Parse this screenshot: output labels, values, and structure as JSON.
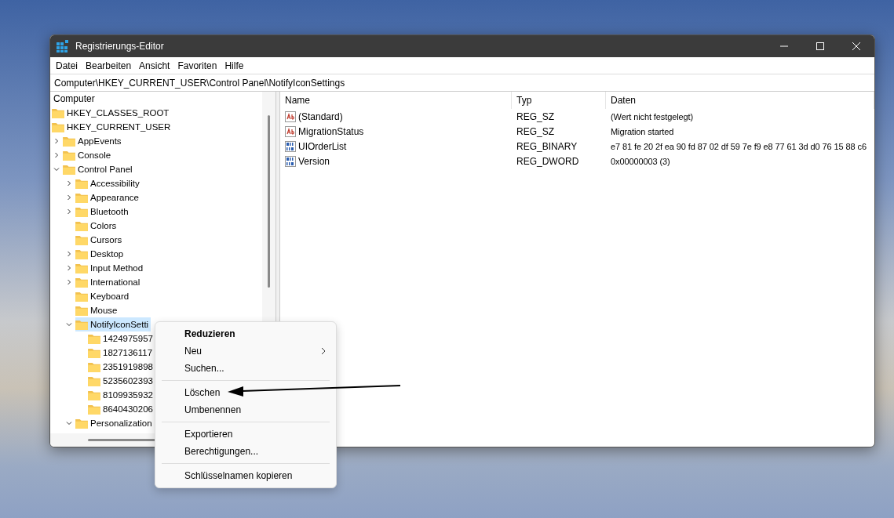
{
  "window": {
    "title": "Registrierungs-Editor"
  },
  "menu_bar": [
    "Datei",
    "Bearbeiten",
    "Ansicht",
    "Favoriten",
    "Hilfe"
  ],
  "address": "Computer\\HKEY_CURRENT_USER\\Control Panel\\NotifyIconSettings",
  "tree": {
    "root": "Computer",
    "items": [
      {
        "label": "HKEY_CLASSES_ROOT",
        "selected": false
      },
      {
        "label": "HKEY_CURRENT_USER",
        "selected": false,
        "children": [
          {
            "label": "AppEvents",
            "expanded": false,
            "selected": false
          },
          {
            "label": "Console",
            "expanded": false,
            "selected": false
          },
          {
            "label": "Control Panel",
            "expanded": true,
            "selected": false,
            "children": [
              {
                "label": "Accessibility",
                "expanded": false,
                "selected": false
              },
              {
                "label": "Appearance",
                "expanded": false,
                "selected": false
              },
              {
                "label": "Bluetooth",
                "expanded": false,
                "selected": false
              },
              {
                "label": "Colors",
                "selected": false
              },
              {
                "label": "Cursors",
                "selected": false
              },
              {
                "label": "Desktop",
                "expanded": false,
                "selected": false
              },
              {
                "label": "Input Method",
                "expanded": false,
                "selected": false
              },
              {
                "label": "International",
                "expanded": false,
                "selected": false
              },
              {
                "label": "Keyboard",
                "selected": false
              },
              {
                "label": "Mouse",
                "selected": false
              },
              {
                "label": "NotifyIconSetti",
                "expanded": true,
                "selected": true,
                "children": [
                  {
                    "label": "1424975957",
                    "selected": false
                  },
                  {
                    "label": "1827136117",
                    "selected": false
                  },
                  {
                    "label": "2351919898",
                    "selected": false
                  },
                  {
                    "label": "5235602393",
                    "selected": false
                  },
                  {
                    "label": "8109935932",
                    "selected": false
                  },
                  {
                    "label": "8640430206",
                    "selected": false
                  }
                ]
              },
              {
                "label": "Personalization",
                "expanded": true,
                "selected": false
              }
            ]
          }
        ]
      }
    ]
  },
  "values": {
    "columns": [
      "Name",
      "Typ",
      "Daten"
    ],
    "rows": [
      {
        "kind": "string",
        "name": "(Standard)",
        "type": "REG_SZ",
        "data": "(Wert nicht festgelegt)"
      },
      {
        "kind": "string",
        "name": "MigrationStatus",
        "type": "REG_SZ",
        "data": "Migration started"
      },
      {
        "kind": "binary",
        "name": "UIOrderList",
        "type": "REG_BINARY",
        "data": "e7 81 fe 20 2f ea 90 fd 87 02 df 59 7e f9 e8 77 61 3d d0 76 15 88 c6"
      },
      {
        "kind": "binary",
        "name": "Version",
        "type": "REG_DWORD",
        "data": "0x00000003 (3)"
      }
    ]
  },
  "context_menu": [
    {
      "kind": "item",
      "label": "Reduzieren",
      "default": true,
      "submenu": false
    },
    {
      "kind": "item",
      "label": "Neu",
      "default": false,
      "submenu": true
    },
    {
      "kind": "item",
      "label": "Suchen...",
      "default": false,
      "submenu": false
    },
    {
      "kind": "separator"
    },
    {
      "kind": "item",
      "label": "Löschen",
      "default": false,
      "submenu": false
    },
    {
      "kind": "item",
      "label": "Umbenennen",
      "default": false,
      "submenu": false
    },
    {
      "kind": "separator"
    },
    {
      "kind": "item",
      "label": "Exportieren",
      "default": false,
      "submenu": false
    },
    {
      "kind": "item",
      "label": "Berechtigungen...",
      "default": false,
      "submenu": false
    },
    {
      "kind": "separator"
    },
    {
      "kind": "item",
      "label": "Schlüsselnamen kopieren",
      "default": false,
      "submenu": false
    }
  ]
}
